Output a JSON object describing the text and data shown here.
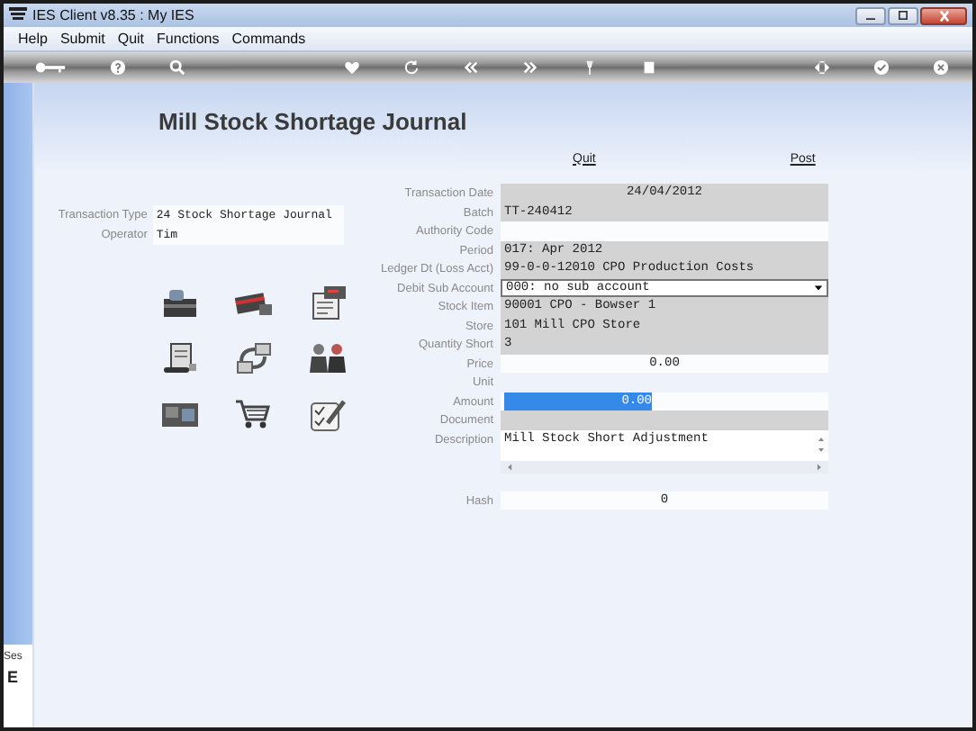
{
  "window": {
    "title": "IES Client v8.35 : My IES"
  },
  "menu": [
    "Help",
    "Submit",
    "Quit",
    "Functions",
    "Commands"
  ],
  "page": {
    "title": "Mill Stock Shortage Journal",
    "actions": [
      "Quit",
      "Post"
    ]
  },
  "header_fields": [
    {
      "label": "Transaction Type",
      "value": "24 Stock Shortage Journal"
    },
    {
      "label": "Operator",
      "value": "Tim"
    }
  ],
  "form": [
    {
      "label": "Transaction Date",
      "value": "24/04/2012",
      "kind": "readonly-centered"
    },
    {
      "label": "Batch",
      "value": "TT-240412",
      "kind": "readonly"
    },
    {
      "label": "Authority Code",
      "kind": "input"
    },
    {
      "label": "Period",
      "value": "017: Apr 2012",
      "kind": "readonly"
    },
    {
      "label": "Ledger Dt (Loss Acct)",
      "value": "99-0-0-12010 CPO Production Costs",
      "kind": "readonly"
    },
    {
      "label": "Debit Sub Account",
      "value": "000: no sub account",
      "kind": "select"
    },
    {
      "label": "Stock Item",
      "value": "90001 CPO - Bowser 1",
      "kind": "readonly"
    },
    {
      "label": "Store",
      "value": "101 Mill CPO Store",
      "kind": "readonly"
    },
    {
      "label": "Quantity Short",
      "value": "3",
      "kind": "readonly"
    },
    {
      "label": "Price",
      "value": "0.00",
      "kind": "input-centered"
    },
    {
      "label": "Unit",
      "kind": "blank"
    },
    {
      "label": "Amount",
      "value": "0.00",
      "kind": "highlighted"
    },
    {
      "label": "Document",
      "kind": "readonly"
    },
    {
      "label": "Description",
      "value": "Mill Stock Short Adjustment",
      "kind": "textarea"
    }
  ],
  "hash": {
    "label": "Hash",
    "value": "0"
  },
  "side": {
    "texts": [
      "Ses",
      "E"
    ]
  }
}
